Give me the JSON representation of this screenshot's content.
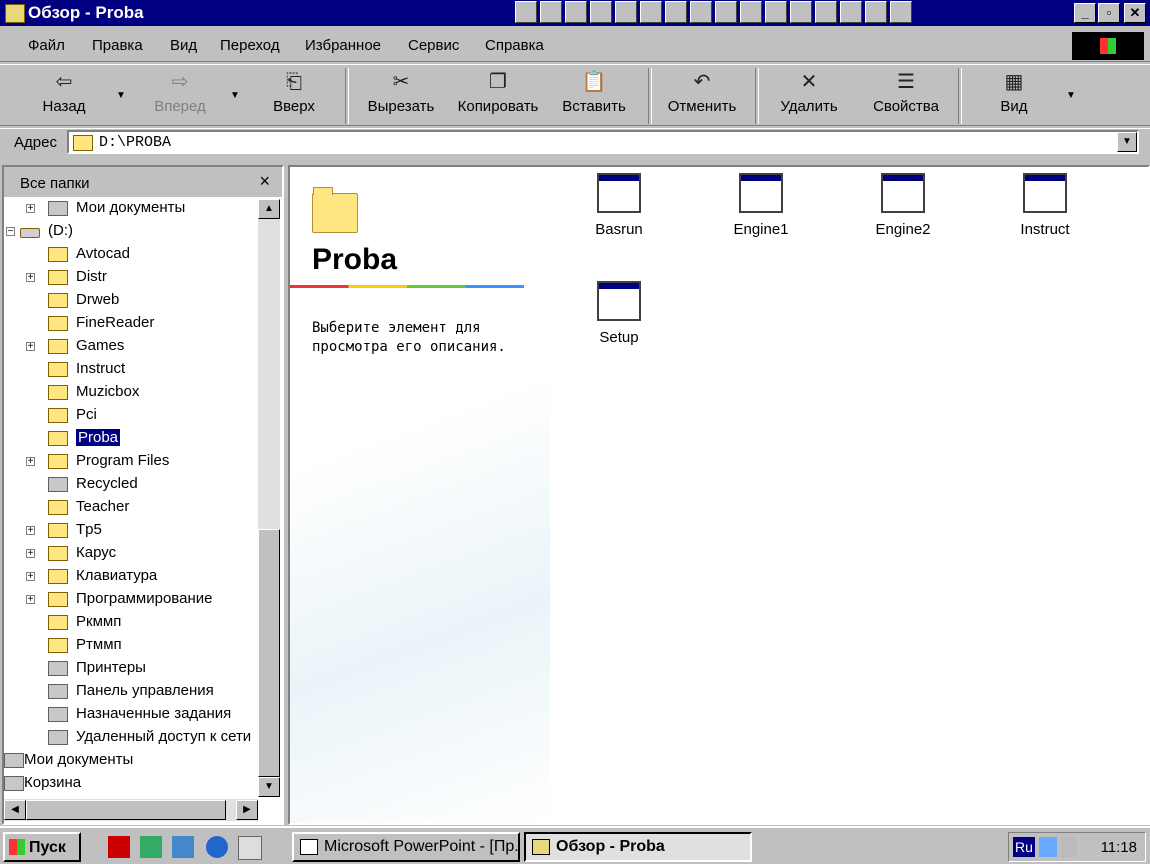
{
  "window": {
    "title": "Обзор - Proba"
  },
  "menu": [
    "Файл",
    "Правка",
    "Вид",
    "Переход",
    "Избранное",
    "Сервис",
    "Справка"
  ],
  "toolbar": {
    "back": "Назад",
    "forward": "Вперед",
    "up": "Вверх",
    "cut": "Вырезать",
    "copy": "Копировать",
    "paste": "Вставить",
    "undo": "Отменить",
    "delete": "Удалить",
    "properties": "Свойства",
    "view": "Вид"
  },
  "address": {
    "label": "Адрес",
    "value": "D:\\PROBA"
  },
  "leftpane": {
    "title": "Все папки",
    "close": "×"
  },
  "tree": [
    {
      "label": "Мои документы",
      "expander": "+",
      "icon": "my-documents-icon"
    },
    {
      "label": "(D:)",
      "expander": "-",
      "icon": "drive-icon"
    },
    {
      "label": "Avtocad",
      "icon": "folder-icon"
    },
    {
      "label": "Distr",
      "expander": "+",
      "icon": "folder-icon"
    },
    {
      "label": "Drweb",
      "icon": "folder-icon"
    },
    {
      "label": "FineReader",
      "icon": "folder-icon"
    },
    {
      "label": "Games",
      "expander": "+",
      "icon": "folder-icon"
    },
    {
      "label": "Instruct",
      "icon": "folder-icon"
    },
    {
      "label": "Muzicbox",
      "icon": "folder-icon"
    },
    {
      "label": "Pci",
      "icon": "folder-icon"
    },
    {
      "label": "Proba",
      "icon": "open-folder-icon",
      "selected": true
    },
    {
      "label": "Program Files",
      "expander": "+",
      "icon": "folder-icon"
    },
    {
      "label": "Recycled",
      "icon": "recycle-bin-icon"
    },
    {
      "label": "Teacher",
      "icon": "folder-icon"
    },
    {
      "label": "Tp5",
      "expander": "+",
      "icon": "folder-icon"
    },
    {
      "label": "Карус",
      "expander": "+",
      "icon": "folder-icon"
    },
    {
      "label": "Клавиатура",
      "expander": "+",
      "icon": "folder-icon"
    },
    {
      "label": "Программирование",
      "expander": "+",
      "icon": "folder-icon"
    },
    {
      "label": "Ркммп",
      "icon": "folder-icon"
    },
    {
      "label": "Ртммп",
      "icon": "folder-icon"
    },
    {
      "label": "Принтеры",
      "icon": "printers-icon"
    },
    {
      "label": "Панель управления",
      "icon": "control-panel-icon"
    },
    {
      "label": "Назначенные задания",
      "icon": "scheduled-tasks-icon"
    },
    {
      "label": "Удаленный доступ к сети",
      "icon": "dial-up-icon"
    },
    {
      "label": "Мои документы",
      "icon": "my-documents-icon"
    },
    {
      "label": "Корзина",
      "icon": "recycle-bin-icon"
    }
  ],
  "webview": {
    "folder_name": "Proba",
    "description": "Выберите элемент для просмотра его описания."
  },
  "files": [
    "Basrun",
    "Engine1",
    "Engine2",
    "Instruct",
    "Setup"
  ],
  "taskbar": {
    "start": "Пуск",
    "tasks": [
      "Microsoft PowerPoint - [Пр...",
      "Обзор - Proba"
    ],
    "lang": "Ru",
    "clock": "11:18"
  }
}
